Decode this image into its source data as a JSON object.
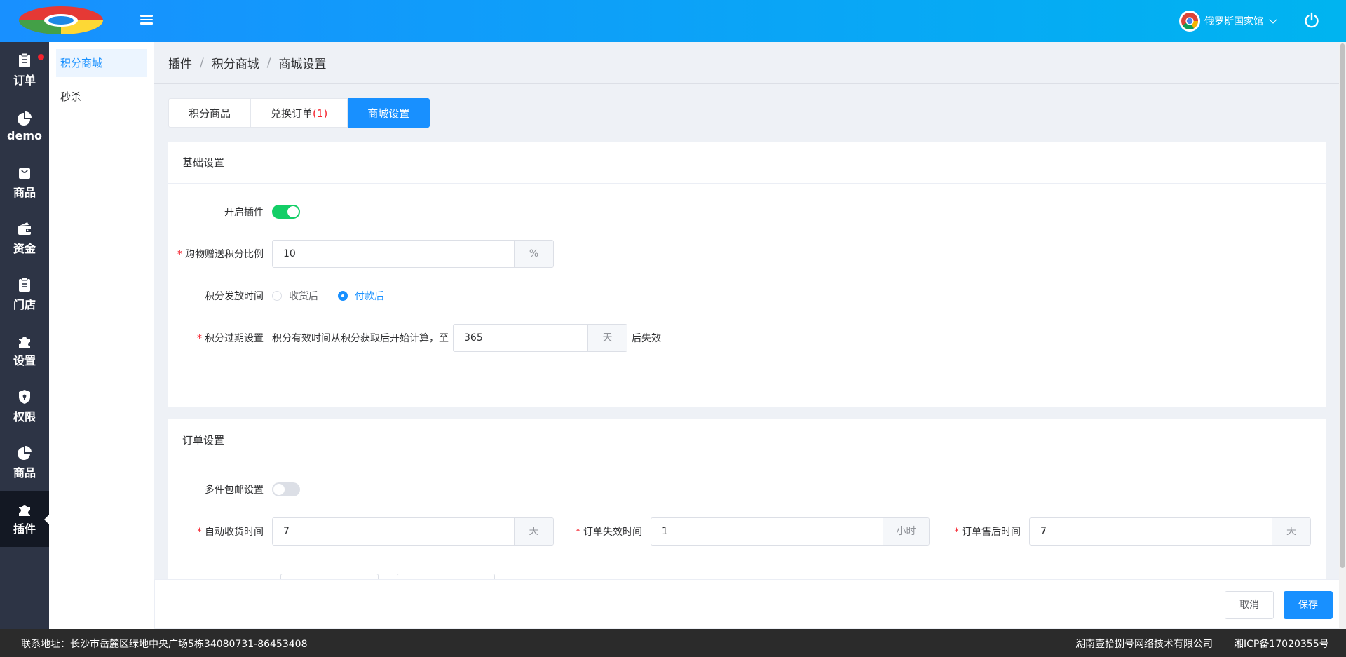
{
  "header": {
    "user_name": "俄罗斯国家馆",
    "icons": [
      "app-logo",
      "hamburger-menu-icon",
      "chrome-avatar-icon",
      "chevron-down-icon",
      "power-icon"
    ]
  },
  "nav": {
    "items": [
      {
        "label": "订单",
        "icon": "clipboard-icon"
      },
      {
        "label": "demo",
        "icon": "pie-chart-icon"
      },
      {
        "label": "商品",
        "icon": "shopping-bag-icon"
      },
      {
        "label": "资金",
        "icon": "wallet-icon"
      },
      {
        "label": "门店",
        "icon": "clipboard-icon"
      },
      {
        "label": "设置",
        "icon": "puzzle-icon"
      },
      {
        "label": "权限",
        "icon": "shield-icon"
      },
      {
        "label": "商品",
        "icon": "pie-chart-icon"
      },
      {
        "label": "插件",
        "icon": "puzzle-icon"
      }
    ],
    "active_index": 8
  },
  "subnav": {
    "items": [
      {
        "label": "积分商城"
      },
      {
        "label": "秒杀"
      }
    ]
  },
  "breadcrumb": {
    "items": [
      "插件",
      "积分商城",
      "商城设置"
    ],
    "separator": "/"
  },
  "tabs": {
    "goods": "积分商品",
    "orders": "兑换订单",
    "orders_badge": "(1)",
    "settings": "商城设置"
  },
  "basic": {
    "title": "基础设置",
    "enable_label": "开启插件",
    "enable_on": true,
    "ratio_label": "购物赠送积分比例",
    "ratio_value": "10",
    "ratio_suffix": "%",
    "issue_label": "积分发放时间",
    "issue_options": [
      "收货后",
      "付款后"
    ],
    "issue_selected": "付款后",
    "expire_label": "积分过期设置",
    "expire_prefix": "积分有效时间从积分获取后开始计算，至",
    "expire_value": "365",
    "expire_suffix": "天",
    "expire_after": "后失效"
  },
  "order": {
    "title": "订单设置",
    "freeship_label": "多件包邮设置",
    "freeship_on": false,
    "auto_receive_label": "自动收货时间",
    "auto_receive_value": "7",
    "auto_receive_suffix": "天",
    "invalid_label": "订单失效时间",
    "invalid_value": "1",
    "invalid_suffix": "小时",
    "aftersale_label": "订单售后时间",
    "aftersale_value": "7",
    "aftersale_suffix": "天"
  },
  "actions": {
    "cancel": "取消",
    "save": "保存"
  },
  "footer": {
    "address": "联系地址：长沙市岳麓区绿地中央广场5栋34080731-86453408",
    "company": "湖南壹拾捌号网络技术有限公司",
    "icp": "湘ICP备17020355号"
  },
  "colors": {
    "primary": "#1890ff",
    "switch_on": "#13ce66",
    "nav_bg": "#2d3445",
    "required": "#f5222d"
  }
}
